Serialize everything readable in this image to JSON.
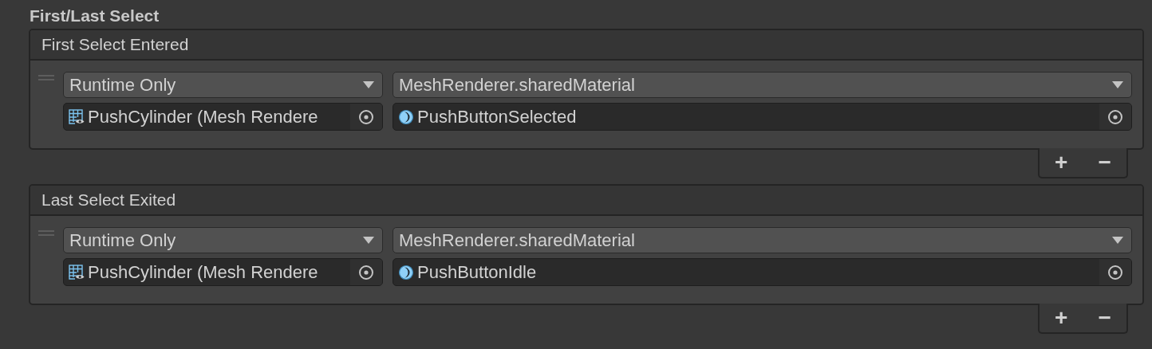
{
  "section_title": "First/Last Select",
  "events": [
    {
      "title": "First Select Entered",
      "listeners": [
        {
          "call_state": "Runtime Only",
          "function": "MeshRenderer.sharedMaterial",
          "target": "PushCylinder (Mesh Rendere",
          "argument": "PushButtonSelected"
        }
      ],
      "footer_buttons": [
        "+",
        "−"
      ]
    },
    {
      "title": "Last Select Exited",
      "listeners": [
        {
          "call_state": "Runtime Only",
          "function": "MeshRenderer.sharedMaterial",
          "target": "PushCylinder (Mesh Rendere",
          "argument": "PushButtonIdle"
        }
      ],
      "footer_buttons": [
        "+",
        "−"
      ]
    }
  ]
}
